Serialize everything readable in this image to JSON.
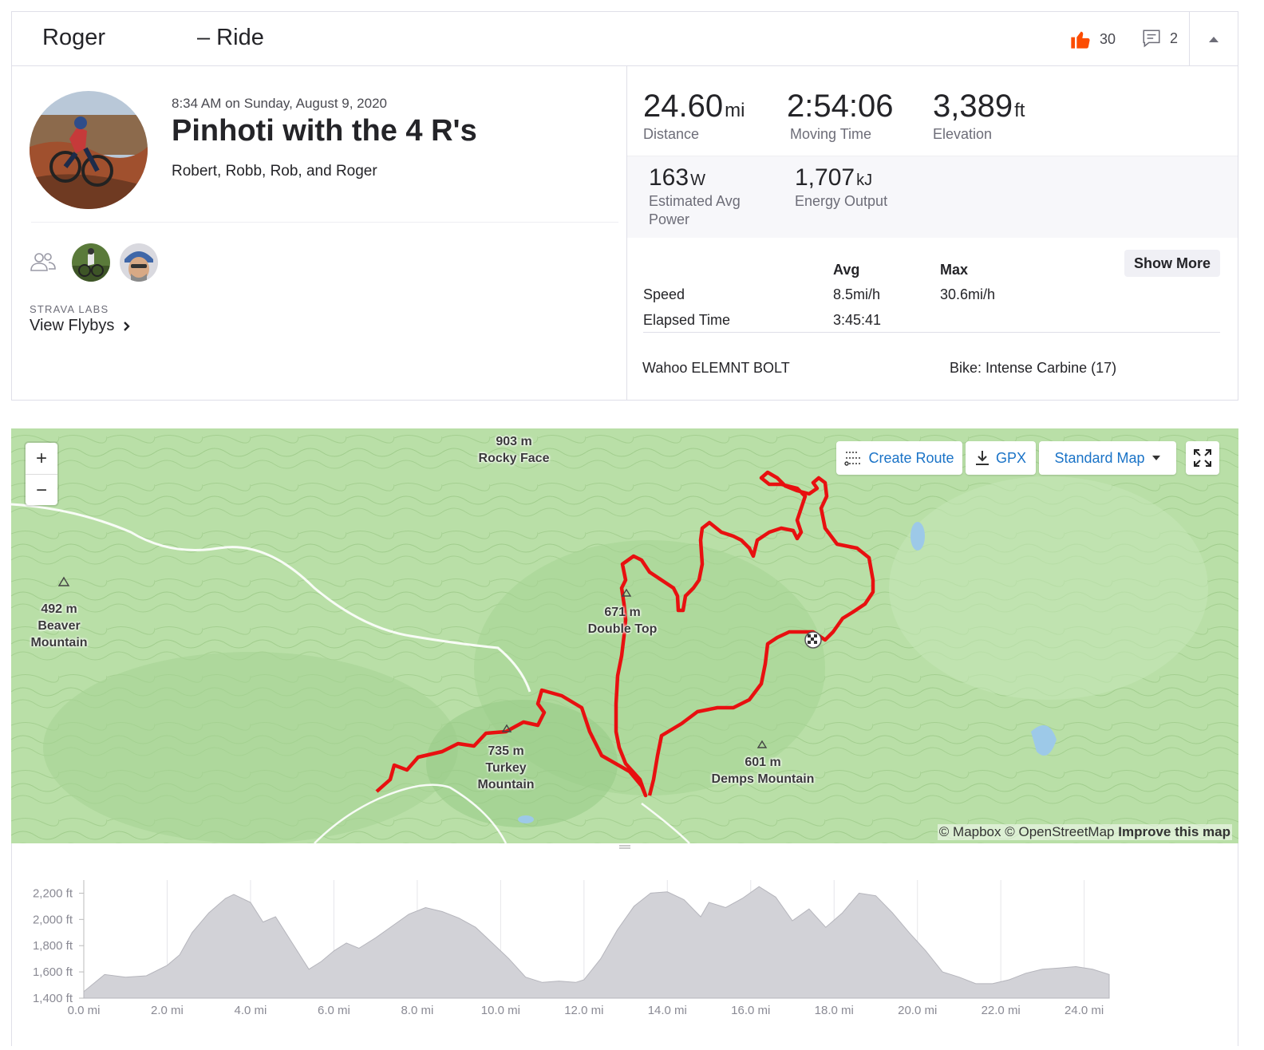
{
  "header": {
    "athlete": "Roger",
    "activity_type": "– Ride",
    "kudos_count": "30",
    "comment_count": "2"
  },
  "activity": {
    "date": "8:34 AM on Sunday, August 9, 2020",
    "title": "Pinhoti with the 4 R's",
    "description": "Robert, Robb, Rob, and Roger"
  },
  "flybys": {
    "label": "STRAVA LABS",
    "link": "View Flybys"
  },
  "stats": {
    "distance": {
      "value": "24.60",
      "unit": "mi",
      "label": "Distance"
    },
    "moving_time": {
      "value": "2:54:06",
      "label": "Moving Time"
    },
    "elevation": {
      "value": "3,389",
      "unit": "ft",
      "label": "Elevation"
    },
    "power": {
      "value": "163",
      "unit": "W",
      "label_line1": "Estimated Avg",
      "label_line2": "Power"
    },
    "energy": {
      "value": "1,707",
      "unit": "kJ",
      "label": "Energy Output"
    }
  },
  "more_stats": {
    "col_avg": "Avg",
    "col_max": "Max",
    "rows": [
      {
        "label": "Speed",
        "avg": "8.5mi/h",
        "max": "30.6mi/h"
      },
      {
        "label": "Elapsed Time",
        "avg": "3:45:41",
        "max": ""
      }
    ],
    "show_more": "Show More"
  },
  "gear": {
    "device": "Wahoo ELEMNT BOLT",
    "bike": "Bike: Intense Carbine (17)"
  },
  "map": {
    "zoom_in": "+",
    "zoom_out": "−",
    "create_route": "Create Route",
    "gpx": "GPX",
    "map_style": "Standard Map",
    "attribution_a": "© Mapbox © OpenStreetMap",
    "attribution_b": "Improve this map",
    "labels": {
      "rocky_face_elev": "903 m",
      "rocky_face_name": "Rocky Face",
      "beaver_elev": "492 m",
      "beaver_name1": "Beaver",
      "beaver_name2": "Mountain",
      "double_top_elev": "671 m",
      "double_top_name": "Double Top",
      "turkey_elev": "735 m",
      "turkey_name1": "Turkey",
      "turkey_name2": "Mountain",
      "demps_elev": "601 m",
      "demps_name": "Demps Mountain"
    },
    "colors": {
      "route": "#e81010",
      "terrain": "#b9dfa7",
      "road": "#ffffff"
    }
  },
  "chart_data": {
    "type": "area",
    "title": "",
    "xlabel": "",
    "ylabel": "",
    "x_ticks": [
      "0.0 mi",
      "2.0 mi",
      "4.0 mi",
      "6.0 mi",
      "8.0 mi",
      "10.0 mi",
      "12.0 mi",
      "14.0 mi",
      "16.0 mi",
      "18.0 mi",
      "20.0 mi",
      "22.0 mi",
      "24.0 mi"
    ],
    "y_ticks": [
      "2,200 ft",
      "2,000 ft",
      "1,800 ft",
      "1,600 ft",
      "1,400 ft"
    ],
    "xlim": [
      0,
      24.6
    ],
    "ylim": [
      1400,
      2300
    ],
    "grid": true,
    "series": [
      {
        "x": [
          0,
          0.5,
          1.0,
          1.5,
          2.0,
          2.3,
          2.6,
          3.0,
          3.4,
          3.6,
          4.0,
          4.3,
          4.6,
          5.0,
          5.4,
          5.7,
          6.0,
          6.3,
          6.6,
          7.0,
          7.4,
          7.8,
          8.2,
          8.6,
          9.0,
          9.4,
          9.8,
          10.2,
          10.6,
          11.0,
          11.4,
          11.8,
          12.0,
          12.4,
          12.8,
          13.2,
          13.6,
          14.0,
          14.4,
          14.8,
          15.0,
          15.4,
          15.8,
          16.2,
          16.6,
          17.0,
          17.4,
          17.8,
          18.2,
          18.6,
          19.0,
          19.4,
          19.8,
          20.2,
          20.6,
          21.0,
          21.4,
          21.8,
          22.2,
          22.6,
          23.0,
          23.4,
          23.8,
          24.2,
          24.6
        ],
        "y": [
          1450,
          1580,
          1560,
          1570,
          1650,
          1730,
          1900,
          2050,
          2160,
          2190,
          2130,
          1980,
          2020,
          1820,
          1620,
          1680,
          1760,
          1820,
          1780,
          1860,
          1950,
          2040,
          2090,
          2060,
          2010,
          1940,
          1820,
          1700,
          1560,
          1520,
          1530,
          1520,
          1540,
          1700,
          1920,
          2100,
          2200,
          2210,
          2150,
          2020,
          2130,
          2090,
          2160,
          2250,
          2170,
          1990,
          2080,
          1940,
          2050,
          2200,
          2180,
          2050,
          1900,
          1760,
          1600,
          1560,
          1510,
          1510,
          1540,
          1590,
          1620,
          1630,
          1640,
          1620,
          1580
        ]
      }
    ]
  }
}
